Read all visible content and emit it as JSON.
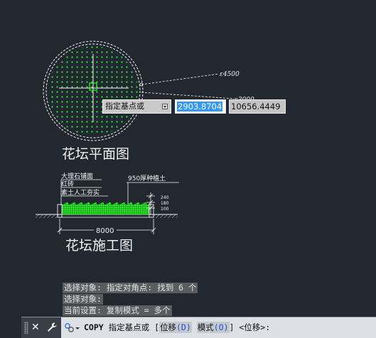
{
  "canvas": {
    "plan_title": "花坛平面图",
    "section_title": "花坛施工图",
    "leader_1": "ε4500",
    "leader_2": "ε3000",
    "section_labels": {
      "marble": "大理石铺面",
      "brick": "红砖",
      "soil": "素土人工夯实",
      "planting_soil": "950厚种植土"
    },
    "dims": {
      "d240": "240",
      "d180": "180",
      "d100": "100",
      "width": "8000"
    }
  },
  "dynamic_input": {
    "prompt": "指定基点或",
    "x_value": "2903.8704",
    "y_value": "10656.4449",
    "dropdown_icon": "chevron-down-icon"
  },
  "history": {
    "line1": "选择对象: 指定对角点: 找到 6 个",
    "line2": "选择对象:",
    "line3": "当前设置:  复制模式 = 多个"
  },
  "command": {
    "name": "COPY",
    "prompt": "指定基点或 [",
    "opt1_label": "位移",
    "opt1_key": "(D)",
    "opt2_label": "模式",
    "opt2_key": "(O)",
    "suffix": "] <位移>:",
    "icons": [
      "close-icon",
      "wrench-icon",
      "command-icon"
    ]
  },
  "colors": {
    "background": "#212830",
    "hatch_green": "#22e022",
    "selection_blue": "#3399ff",
    "linework": "#f2f2f2"
  }
}
